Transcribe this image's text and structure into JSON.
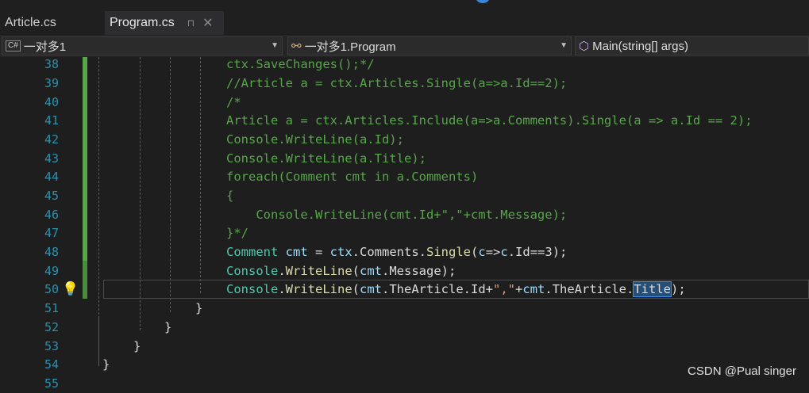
{
  "tabs": {
    "inactive": "Article.cs",
    "active": "Program.cs",
    "pin": "⊓",
    "close": "✕"
  },
  "nav": {
    "project_icon": "C#",
    "project": "一对多1",
    "class_icon": "class-icon",
    "class": "一对多1.Program",
    "method_icon": "method-icon",
    "method": "Main(string[] args)"
  },
  "line_numbers": [
    "38",
    "39",
    "40",
    "41",
    "42",
    "43",
    "44",
    "45",
    "46",
    "47",
    "48",
    "49",
    "50",
    "51",
    "52",
    "53",
    "54",
    "55"
  ],
  "code": {
    "l38": "ctx.SaveChanges();*/",
    "l39": "//Article a = ctx.Articles.Single(a=>a.Id==2);",
    "l40": "/*",
    "l41": "Article a = ctx.Articles.Include(a=>a.Comments).Single(a => a.Id == 2);",
    "l42": "Console.WriteLine(a.Id);",
    "l43": "Console.WriteLine(a.Title);",
    "l44": "foreach(Comment cmt in a.Comments)",
    "l45": "{",
    "l46": "    Console.WriteLine(cmt.Id+\",\"+cmt.Message);",
    "l47": "}*/",
    "l48": {
      "t1": "Comment",
      "t2": " ",
      "t3": "cmt",
      "t4": " = ",
      "t5": "ctx",
      "t6": ".Comments.",
      "t7": "Single",
      "t8": "(",
      "t9": "c",
      "t10": "=>",
      "t11": "c",
      "t12": ".Id==3);"
    },
    "l49": {
      "t1": "Console",
      "t2": ".",
      "t3": "WriteLine",
      "t4": "(",
      "t5": "cmt",
      "t6": ".Message);"
    },
    "l50": {
      "t1": "Console",
      "t2": ".",
      "t3": "WriteLine",
      "t4": "(",
      "t5": "cmt",
      "t6": ".TheArticle.Id+",
      "t7": "\",\"",
      "t8": "+",
      "t9": "cmt",
      "t10": ".TheArticle.",
      "t11": "Title",
      "t12": ");"
    },
    "l51": "}",
    "l52": "}",
    "l53": "}",
    "l54": "}"
  },
  "lightbulb": "💡",
  "watermark": "CSDN @Pual singer",
  "colors": {
    "line_number": "#2b91af",
    "comment": "#57a64a",
    "keyword_type": "#4ec9b0",
    "method": "#dcdcaa",
    "identifier": "#9cdcfe",
    "string": "#d69d85"
  }
}
